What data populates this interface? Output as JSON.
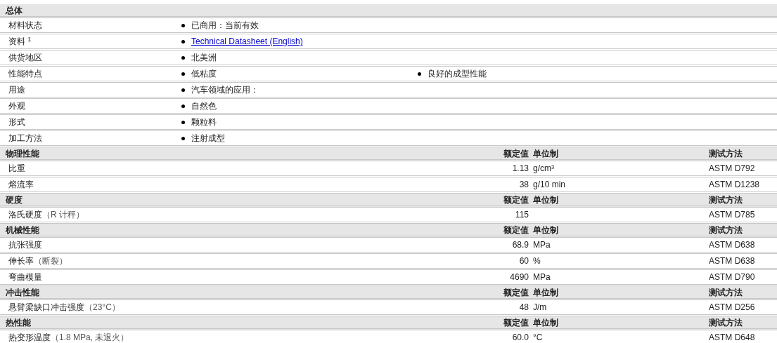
{
  "general": {
    "title": "总体",
    "rows": [
      {
        "label": "材料状态",
        "values": [
          {
            "kind": "text",
            "text": "已商用：当前有效"
          }
        ]
      },
      {
        "label": "资料 $^{1}$",
        "values": [
          {
            "kind": "link",
            "text": "Technical Datasheet (English)"
          }
        ]
      },
      {
        "label": "供货地区",
        "values": [
          {
            "kind": "text",
            "text": "北美洲"
          }
        ]
      },
      {
        "label": "性能特点",
        "values": [
          {
            "kind": "text",
            "text": "低粘度"
          },
          {
            "kind": "text",
            "text": "良好的成型性能"
          }
        ]
      },
      {
        "label": "用途",
        "values": [
          {
            "kind": "text",
            "text": "汽车领域的应用："
          }
        ]
      },
      {
        "label": "外观",
        "values": [
          {
            "kind": "text",
            "text": "自然色"
          }
        ]
      },
      {
        "label": "形式",
        "values": [
          {
            "kind": "text",
            "text": "颗粒料"
          }
        ]
      },
      {
        "label": "加工方法",
        "values": [
          {
            "kind": "text",
            "text": "注射成型"
          }
        ]
      }
    ]
  },
  "sections": [
    {
      "title": "物理性能",
      "columns": [
        "额定值",
        "单位制",
        "测试方法"
      ],
      "rows": [
        {
          "name": "比重",
          "value": "1.13",
          "unit": "g/cm³",
          "method": "ASTM D792"
        },
        {
          "name": "熔流率",
          "value": "38",
          "unit": "g/10 min",
          "method": "ASTM D1238"
        }
      ]
    },
    {
      "title": "硬度",
      "columns": [
        "额定值",
        "单位制",
        "测试方法"
      ],
      "rows": [
        {
          "name": "洛氏硬度",
          "condition": "（R 计秤）",
          "value": "115",
          "method": "ASTM D785"
        }
      ]
    },
    {
      "title": "机械性能",
      "columns": [
        "额定值",
        "单位制",
        "测试方法"
      ],
      "rows": [
        {
          "name": "抗张强度",
          "value": "68.9",
          "unit": "MPa",
          "method": "ASTM D638"
        },
        {
          "name": "伸长率",
          "condition": "（断裂）",
          "value": "60",
          "unit": "%",
          "method": "ASTM D638"
        },
        {
          "name": "弯曲模量",
          "value": "4690",
          "unit": "MPa",
          "method": "ASTM D790"
        }
      ]
    },
    {
      "title": "冲击性能",
      "columns": [
        "额定值",
        "单位制",
        "测试方法"
      ],
      "rows": [
        {
          "name": "悬臂梁缺口冲击强度",
          "condition": "（23°C）",
          "value": "48",
          "unit": "J/m",
          "method": "ASTM D256"
        }
      ]
    },
    {
      "title": "热性能",
      "columns": [
        "额定值",
        "单位制",
        "测试方法"
      ],
      "rows": [
        {
          "name": "热变形温度",
          "condition": "（1.8 MPa, 未退火）",
          "value": "60.0",
          "unit": "°C",
          "method": "ASTM D648"
        }
      ]
    }
  ]
}
